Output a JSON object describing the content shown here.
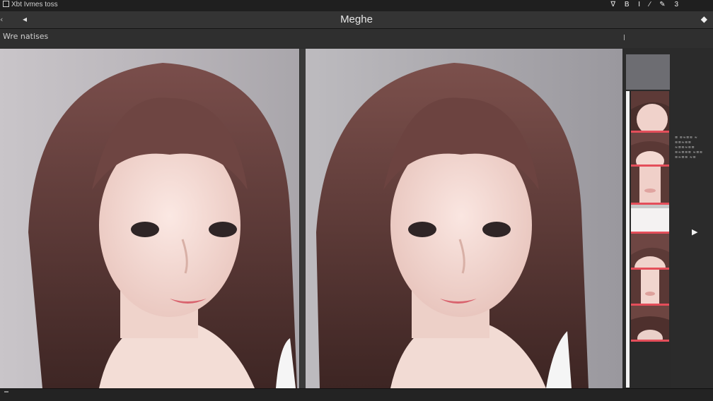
{
  "top_bar": {
    "app_title": "Xbt Ivmes toss",
    "tool_icons": "∇ B I ∕ ✎ 3"
  },
  "title_bar": {
    "back_glyph": "◂",
    "left_glyph": "‹",
    "title": "Meghe",
    "right_glyph": "◆"
  },
  "label_bar": {
    "label": "Wre natises"
  },
  "thumbnails": [
    {
      "name": "thumb-1"
    },
    {
      "name": "thumb-2"
    },
    {
      "name": "thumb-3"
    },
    {
      "name": "thumb-4"
    },
    {
      "name": "thumb-5"
    },
    {
      "name": "thumb-6"
    }
  ],
  "side_panel": {
    "text": "≡ ≋≈≡≋ ≈ ≋≡≈≋≡ ≈≡≋≈≋≡ ≋≈≡≋≡ ≈≡≋ ≋≈≡≋ ≈≋"
  },
  "colors": {
    "accent": "#e44e5a",
    "hair": "#5b3a36",
    "skin": "#f3dcd6"
  },
  "icons": [
    "app-icon",
    "back-arrow-icon",
    "diamond-icon",
    "play-arrow-icon"
  ]
}
